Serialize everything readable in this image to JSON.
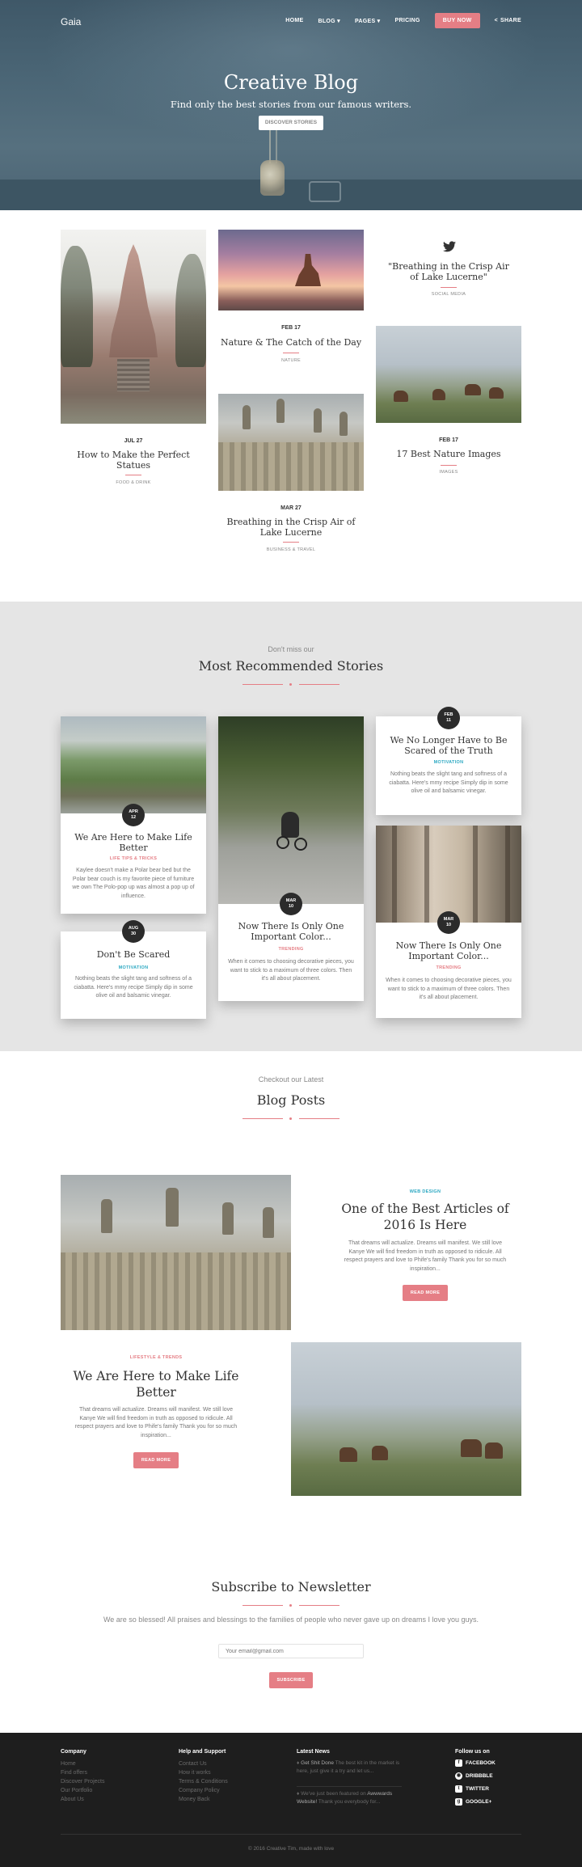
{
  "nav": {
    "brand": "Gaia",
    "items": [
      "HOME",
      "BLOG ▾",
      "PAGES ▾",
      "PRICING"
    ],
    "buy": "BUY NOW",
    "share": "SHARE"
  },
  "hero": {
    "title": "Creative Blog",
    "subtitle": "Find only the best stories from our famous writers.",
    "button": "DISCOVER STORIES"
  },
  "grid": {
    "col1": {
      "date": "JUL 27",
      "title": "How to Make the Perfect Statues",
      "category": "FOOD & DRINK"
    },
    "col2a": {
      "date": "FEB 17",
      "title": "Nature & The Catch of the Day",
      "category": "NATURE"
    },
    "col2b": {
      "date": "MAR 27",
      "title": "Breathing in the Crisp Air of Lake Lucerne",
      "category": "BUSINESS & TRAVEL"
    },
    "col3tweet": {
      "title": "\"Breathing in the Crisp Air of Lake Lucerne\"",
      "category": "SOCIAL MEDIA"
    },
    "col3b": {
      "date": "FEB 17",
      "title": "17 Best Nature Images",
      "category": "IMAGES"
    }
  },
  "recommended": {
    "pre": "Don't miss our",
    "title": "Most Recommended Stories",
    "c1": {
      "month": "APR",
      "day": "12",
      "title": "We Are Here to Make Life Better",
      "tag": "LIFE TIPS & TRICKS",
      "text": "Kaylee doesn't make a Polar bear bed but the Polar bear couch is my favorite piece of furniture we own The Polo-pop up was almost a pop up of influence."
    },
    "c2": {
      "month": "AUG",
      "day": "30",
      "title": "Don't Be Scared",
      "tag": "MOTIVATION",
      "text": "Nothing beats the slight tang and softness of a ciabatta. Here's mmy recipe Simply dip in some olive oil and balsamic vinegar."
    },
    "c3": {
      "month": "MAR",
      "day": "10",
      "title": "Now There Is Only One Important Color...",
      "tag": "TRENDING",
      "text": "When it comes to choosing decorative pieces, you want to stick to a maximum of three colors. Then it's all about placement."
    },
    "c4": {
      "month": "FEB",
      "day": "11",
      "title": "We No Longer Have to Be Scared of the Truth",
      "tag": "MOTIVATION",
      "text": "Nothing beats the slight tang and softness of a ciabatta. Here's mmy recipe Simply dip in some olive oil and balsamic vinegar."
    },
    "c5": {
      "month": "MAR",
      "day": "10",
      "title": "Now There Is Only One Important Color...",
      "tag": "TRENDING",
      "text": "When it comes to choosing decorative pieces, you want to stick to a maximum of three colors. Then it's all about placement."
    }
  },
  "latest": {
    "pre": "Checkout our Latest",
    "title": "Blog Posts",
    "p1": {
      "tag": "WEB DESIGN",
      "title": "One of the Best Articles of 2016 Is Here",
      "text": "That dreams will actualize. Dreams will manifest. We still love Kanye We will find freedom in truth as opposed to ridicule. All respect prayers and love to Phife's family Thank you for so much inspiration...",
      "button": "READ MORE"
    },
    "p2": {
      "tag": "LIFESTYLE & TRENDS",
      "title": "We Are Here to Make Life Better",
      "text": "That dreams will actualize. Dreams will manifest. We still love Kanye We will find freedom in truth as opposed to ridicule. All respect prayers and love to Phife's family Thank you for so much inspiration...",
      "button": "READ MORE"
    }
  },
  "newsletter": {
    "title": "Subscribe to Newsletter",
    "text": "We are so blessed! All praises and blessings to the families of people who never gave up on dreams I love you guys.",
    "placeholder": "Your email@gmail.com",
    "button": "SUBSCRIBE"
  },
  "footer": {
    "company": {
      "heading": "Company",
      "links": [
        "Home",
        "Find offers",
        "Discover Projects",
        "Our Portfolio",
        "About Us"
      ]
    },
    "help": {
      "heading": "Help and Support",
      "links": [
        "Contact Us",
        "How it works",
        "Terms & Conditions",
        "Company Policy",
        "Money Back"
      ]
    },
    "news": {
      "heading": "Latest News",
      "n1_title": "Get Shit Done",
      "n1_text": "The best kit in the market is here, just give it a try and let us...",
      "n2_title": "Awwwards Website!",
      "n2_lead": "We've just been featured on",
      "n2_text": "Thank you everybody for..."
    },
    "follow": {
      "heading": "Follow us on",
      "links": [
        "FACEBOOK",
        "DRIBBBLE",
        "TWITTER",
        "GOOGLE+"
      ]
    },
    "copyright": "© 2016 Creative Tim, made with love"
  },
  "colors": {
    "accent": "#e57e85",
    "teal": "#2ca8c2",
    "dark": "#1e1e1e"
  }
}
